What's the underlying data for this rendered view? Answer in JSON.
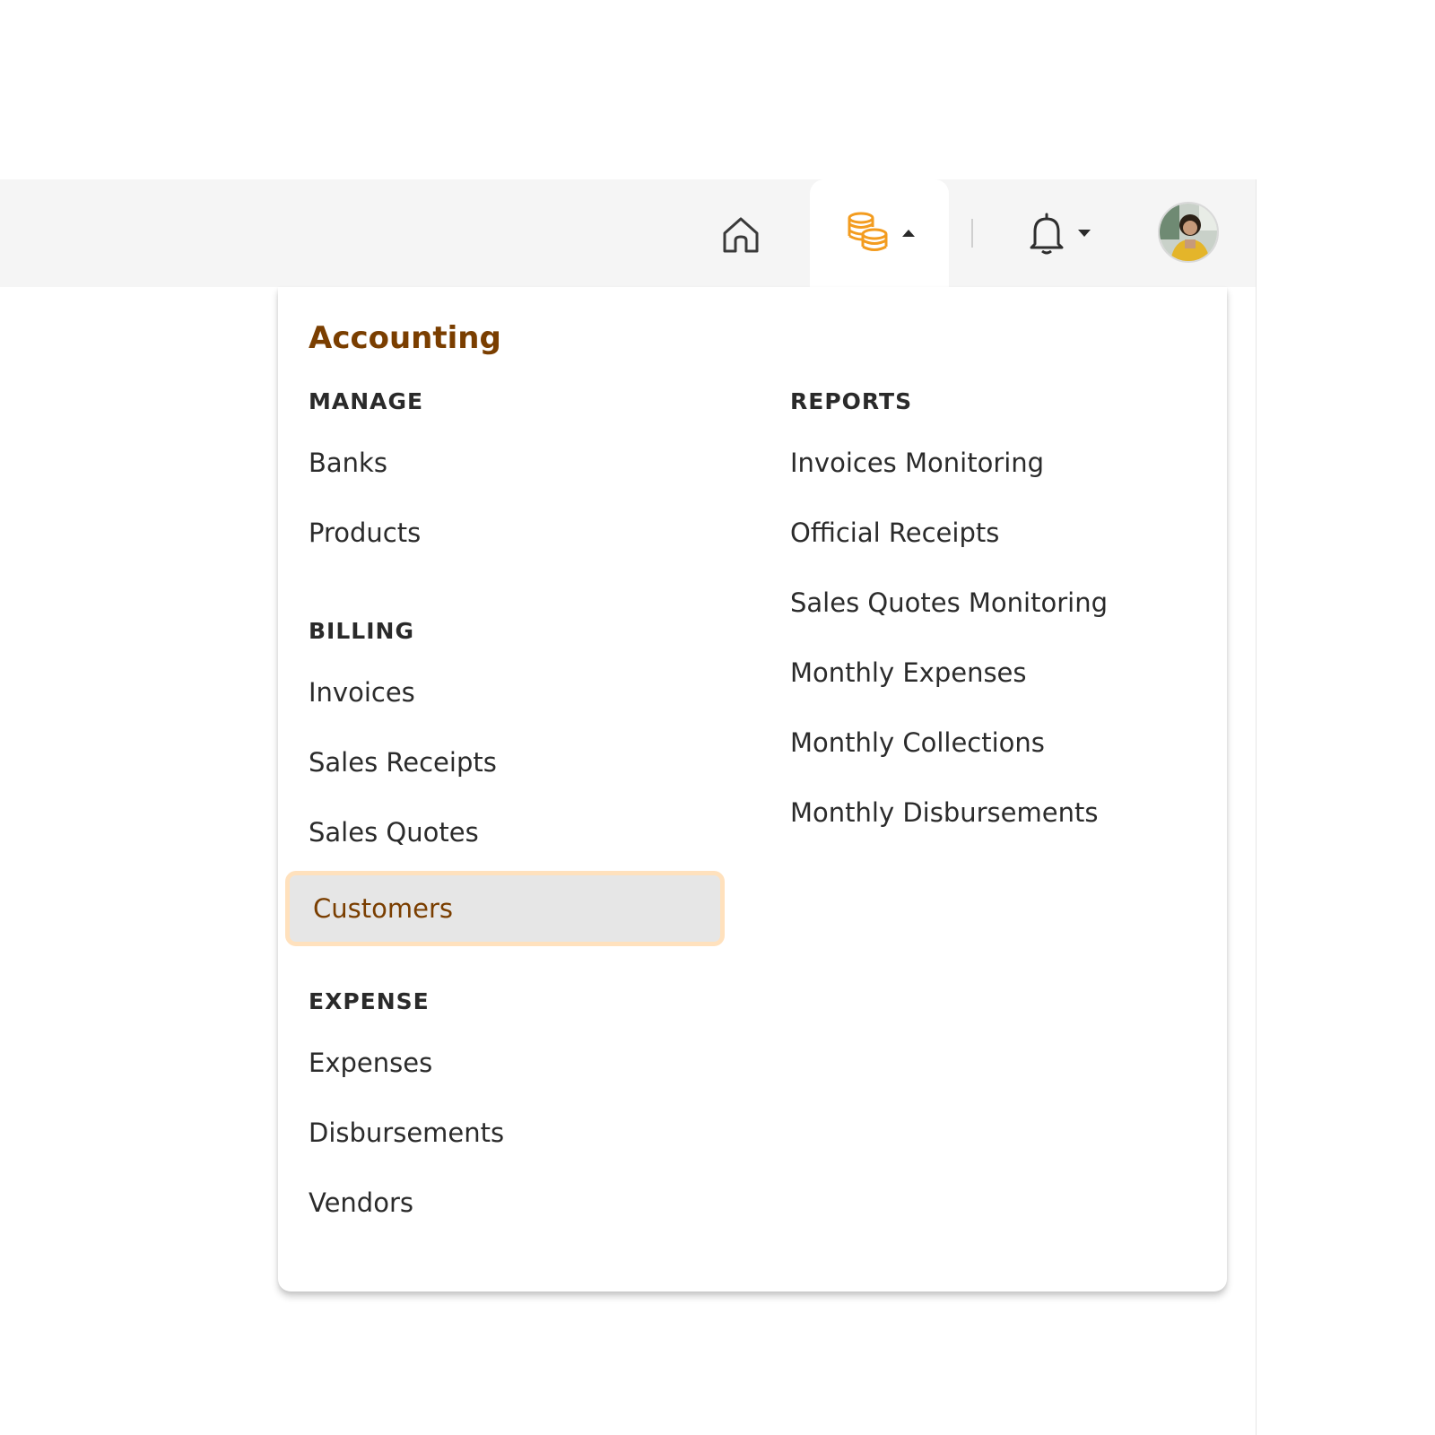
{
  "navbar": {
    "home_icon": "home-icon",
    "accounting_icon": "coins-stack-icon",
    "accounting_caret": "caret-up-icon",
    "notifications_icon": "bell-icon",
    "notifications_caret": "caret-down-icon",
    "avatar": "user-avatar",
    "accent_color": "#f39c1f"
  },
  "dropdown": {
    "title": "Accounting",
    "title_color": "#7a3e00",
    "active_item": "Customers",
    "manage": {
      "heading": "MANAGE",
      "items": [
        "Banks",
        "Products"
      ]
    },
    "billing": {
      "heading": "BILLING",
      "items": [
        "Invoices",
        "Sales Receipts",
        "Sales Quotes",
        "Customers"
      ]
    },
    "expense": {
      "heading": "EXPENSE",
      "items": [
        "Expenses",
        "Disbursements",
        "Vendors"
      ]
    },
    "reports": {
      "heading": "REPORTS",
      "items": [
        "Invoices Monitoring",
        "Official Receipts",
        "Sales Quotes Monitoring",
        "Monthly Expenses",
        "Monthly Collections",
        "Monthly Disbursements"
      ]
    }
  }
}
